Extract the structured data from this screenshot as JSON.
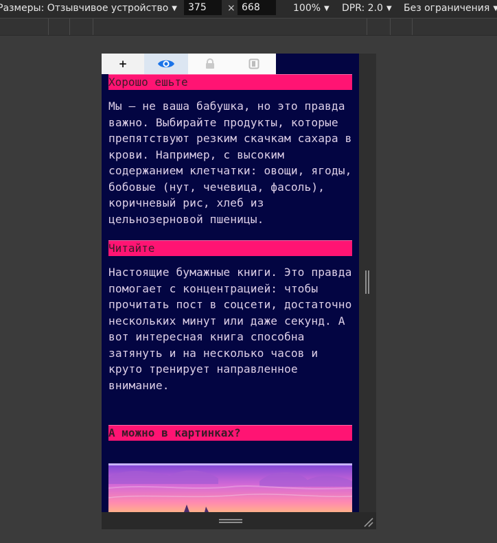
{
  "toolbar": {
    "device_label": "Размеры: Отзывчивое устройство",
    "width_value": "375",
    "times_symbol": "×",
    "height_value": "668",
    "zoom_label": "100%",
    "dpr_label": "DPR: 2.0",
    "throttle_label": "Без ограничения"
  },
  "tabs": {
    "add_label": "+"
  },
  "page": {
    "sections": [
      {
        "heading": "Хорошо ешьте",
        "text": "Мы — не ваша бабушка, но это правда важно. Выбирайте продукты, которые препятствуют резким скачкам сахара в крови. Например, с высоким содержанием клетчатки: овощи, ягоды, бобовые (нут, чечевица, фасоль), коричневый рис, хлеб из цельнозерновой пшеницы."
      },
      {
        "heading": "Читайте",
        "text": "Настоящие бумажные книги. Это правда помогает с концентрацией: чтобы прочитать пост в соцсети, достаточно нескольких минут или даже секунд. А вот интересная книга способна затянуть и на несколько часов и круто тренирует направленное внимание."
      },
      {
        "heading": "А можно в картинках?"
      }
    ]
  },
  "colors": {
    "page_bg": "#030542",
    "heading_bg": "#ff1473",
    "text": "#ded0e8",
    "accent_eye": "#1a73e8"
  }
}
